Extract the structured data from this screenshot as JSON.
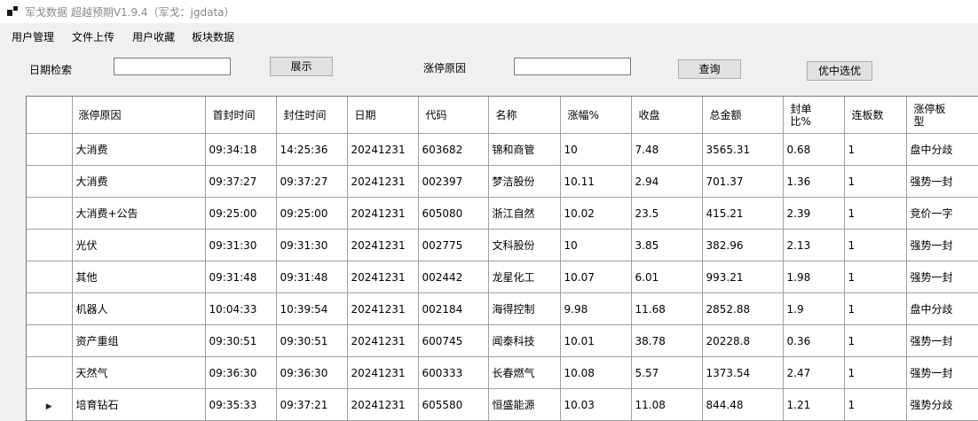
{
  "window": {
    "title": "军戈数据 超越预期V1.9.4（军戈：jgdata）"
  },
  "menu": [
    "用户管理",
    "文件上传",
    "用户收藏",
    "板块数据"
  ],
  "toolbar": {
    "date_label": "日期检索",
    "date_value": "",
    "show_button": "展示",
    "reason_label": "涨停原因",
    "reason_value": "",
    "query_button": "查询",
    "select_button": "优中选优"
  },
  "table": {
    "columns": [
      "涨停原因",
      "首封时间",
      "封住时间",
      "日期",
      "代码",
      "名称",
      "涨幅%",
      "收盘",
      "总金额",
      "封单比%",
      "连板数",
      "涨停板型"
    ],
    "rows": [
      [
        "大消费",
        "09:34:18",
        "14:25:36",
        "20241231",
        "603682",
        "锦和商管",
        "10",
        "7.48",
        "3565.31",
        "0.68",
        "1",
        "盘中分歧"
      ],
      [
        "大消费",
        "09:37:27",
        "09:37:27",
        "20241231",
        "002397",
        "梦洁股份",
        "10.11",
        "2.94",
        "701.37",
        "1.36",
        "1",
        "强势一封"
      ],
      [
        "大消费+公告",
        "09:25:00",
        "09:25:00",
        "20241231",
        "605080",
        "浙江自然",
        "10.02",
        "23.5",
        "415.21",
        "2.39",
        "1",
        "竞价一字"
      ],
      [
        "光伏",
        "09:31:30",
        "09:31:30",
        "20241231",
        "002775",
        "文科股份",
        "10",
        "3.85",
        "382.96",
        "2.13",
        "1",
        "强势一封"
      ],
      [
        "其他",
        "09:31:48",
        "09:31:48",
        "20241231",
        "002442",
        "龙星化工",
        "10.07",
        "6.01",
        "993.21",
        "1.98",
        "1",
        "强势一封"
      ],
      [
        "机器人",
        "10:04:33",
        "10:39:54",
        "20241231",
        "002184",
        "海得控制",
        "9.98",
        "11.68",
        "2852.88",
        "1.9",
        "1",
        "盘中分歧"
      ],
      [
        "资产重组",
        "09:30:51",
        "09:30:51",
        "20241231",
        "600745",
        "闻泰科技",
        "10.01",
        "38.78",
        "20228.8",
        "0.36",
        "1",
        "强势一封"
      ],
      [
        "天然气",
        "09:36:30",
        "09:36:30",
        "20241231",
        "600333",
        "长春燃气",
        "10.08",
        "5.57",
        "1373.54",
        "2.47",
        "1",
        "强势一封"
      ],
      [
        "培育钻石",
        "09:35:33",
        "09:37:21",
        "20241231",
        "605580",
        "恒盛能源",
        "10.03",
        "11.08",
        "844.48",
        "1.21",
        "1",
        "强势分歧"
      ]
    ],
    "current_row_marker": "▶"
  }
}
